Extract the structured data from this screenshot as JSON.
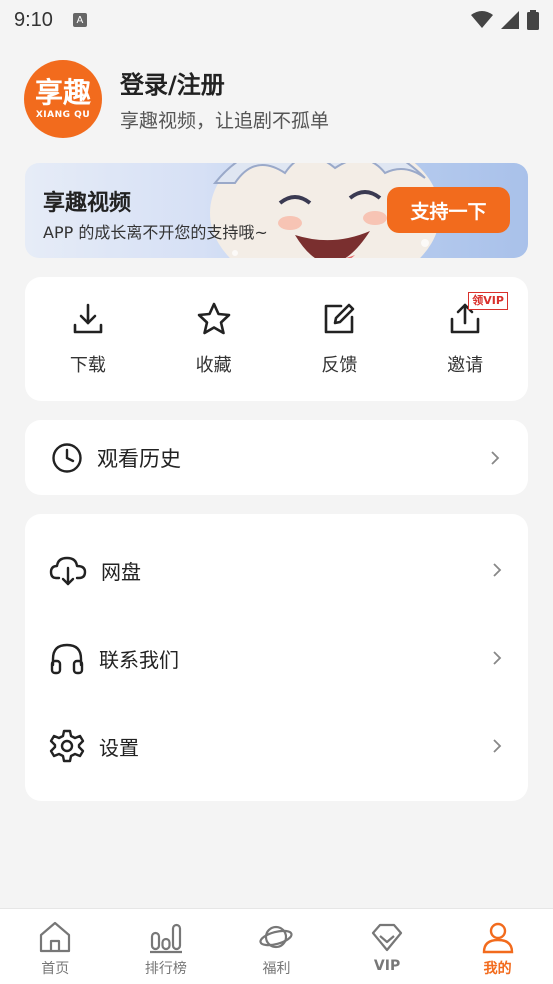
{
  "status_bar": {
    "time": "9:10",
    "notification_icon": "a-notification-icon"
  },
  "profile": {
    "avatar_text": "享趣",
    "avatar_subtext": "XIANG QU",
    "title": "登录/注册",
    "subtitle": "享趣视频，让追剧不孤单"
  },
  "banner": {
    "title": "享趣视频",
    "subtitle": "APP 的成长离不开您的支持哦~",
    "button": "支持一下"
  },
  "quick_actions": [
    {
      "label": "下载",
      "icon": "download-icon"
    },
    {
      "label": "收藏",
      "icon": "star-icon"
    },
    {
      "label": "反馈",
      "icon": "edit-icon"
    },
    {
      "label": "邀请",
      "icon": "share-icon",
      "badge": "领VIP"
    }
  ],
  "history": {
    "label": "观看历史",
    "icon": "clock-icon"
  },
  "menu": [
    {
      "label": "网盘",
      "icon": "cloud-download-icon"
    },
    {
      "label": "联系我们",
      "icon": "headphones-icon"
    },
    {
      "label": "设置",
      "icon": "gear-icon"
    }
  ],
  "tabs": [
    {
      "label": "首页",
      "icon": "home-icon",
      "active": false
    },
    {
      "label": "排行榜",
      "icon": "ranking-icon",
      "active": false
    },
    {
      "label": "福利",
      "icon": "planet-icon",
      "active": false
    },
    {
      "label": "VIP",
      "icon": "diamond-icon",
      "active": false
    },
    {
      "label": "我的",
      "icon": "user-icon",
      "active": true
    }
  ],
  "colors": {
    "accent": "#f26b1d",
    "background": "#f4f4f4",
    "card": "#ffffff",
    "badge": "#d9302b"
  }
}
